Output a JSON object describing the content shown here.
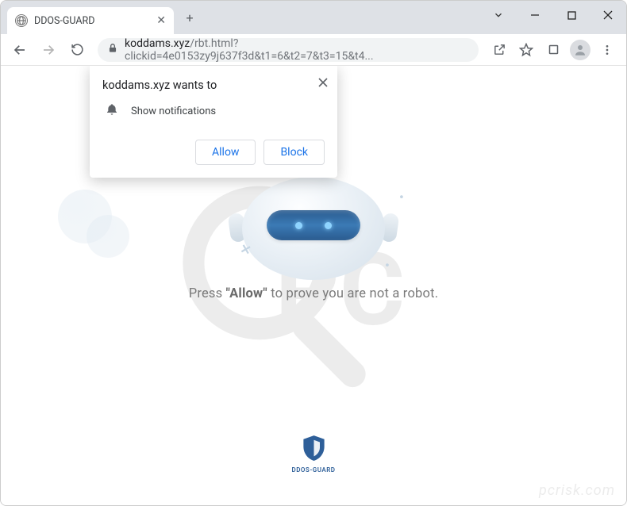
{
  "window": {
    "tab_title": "DDOS-GUARD"
  },
  "toolbar": {
    "url_host": "koddams.xyz",
    "url_path": "/rbt.html?clickid=4e0153zy9j637f3d&t1=6&t2=7&t3=15&t4..."
  },
  "permission_dialog": {
    "title": "koddams.xyz wants to",
    "request_text": "Show notifications",
    "allow_label": "Allow",
    "block_label": "Block"
  },
  "page": {
    "prompt_prefix": "Press ",
    "prompt_bold": "\"Allow\"",
    "prompt_suffix": " to prove you are not a robot.",
    "footer_label": "DDOS-GUARD"
  },
  "watermark": {
    "site": "pcrisk.com"
  },
  "colors": {
    "accent": "#1a73e8",
    "shield": "#2e5f99"
  }
}
